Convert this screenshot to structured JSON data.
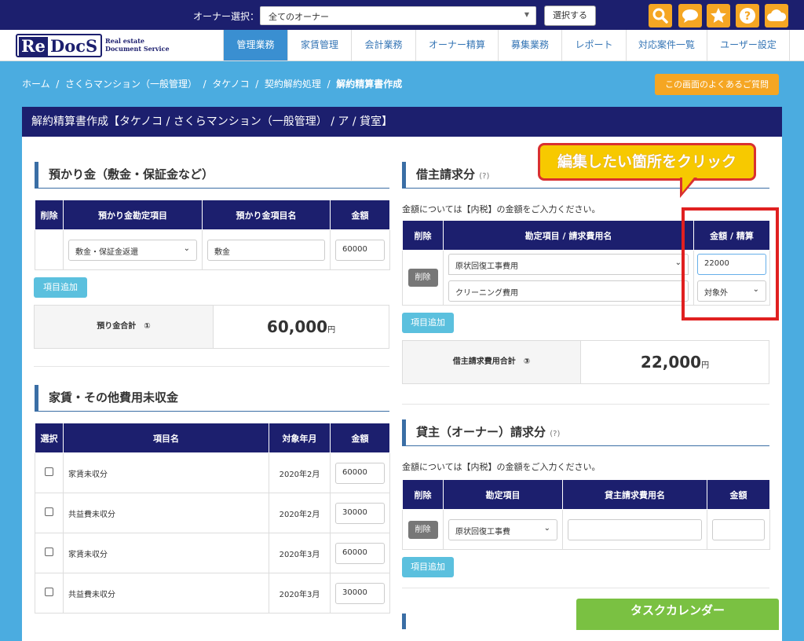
{
  "topbar": {
    "owner_label": "オーナー選択：",
    "owner_select_value": "全てのオーナー",
    "select_button": "選択する",
    "icons": [
      "search-icon",
      "chat-icon",
      "star-icon",
      "help-icon",
      "cloud-icon"
    ],
    "accent": "#f5a623"
  },
  "logo": {
    "re": "Re",
    "docs": "DocS",
    "sub1": "Real estate",
    "sub2": "Document Service"
  },
  "nav": {
    "items": [
      "管理業務",
      "家賃管理",
      "会計業務",
      "オーナー精算",
      "募集業務",
      "レポート",
      "対応案件一覧",
      "ユーザー設定"
    ],
    "active_index": 0
  },
  "breadcrumb": {
    "items": [
      "ホーム",
      "さくらマンション（一般管理）",
      "タケノコ",
      "契約解約処理"
    ],
    "current": "解約精算書作成",
    "sep": "/"
  },
  "faq_button": "この画面のよくあるご質問",
  "page_title": "解約精算書作成【タケノコ / さくらマンション（一般管理） / ア / 貸室】",
  "deposit": {
    "title": "預かり金（敷金・保証金など）",
    "headers": [
      "削除",
      "預かり金勘定項目",
      "預かり金項目名",
      "金額"
    ],
    "row": {
      "account": "敷金・保証金返還",
      "name": "敷金",
      "amount": "60000"
    },
    "add_button": "項目追加",
    "sum_label": "預り金合計　①",
    "sum_value": "60,000",
    "unit": "円"
  },
  "arrears": {
    "title": "家賃・その他費用未収金",
    "headers": [
      "選択",
      "項目名",
      "対象年月",
      "金額"
    ],
    "rows": [
      {
        "name": "家賃未収分",
        "month": "2020年2月",
        "amount": "60000"
      },
      {
        "name": "共益費未収分",
        "month": "2020年2月",
        "amount": "30000"
      },
      {
        "name": "家賃未収分",
        "month": "2020年3月",
        "amount": "60000"
      },
      {
        "name": "共益費未収分",
        "month": "2020年3月",
        "amount": "30000"
      }
    ]
  },
  "tenant": {
    "title": "借主請求分",
    "help": "(?)",
    "note": "金額については【内税】の金額をご入力ください。",
    "headers": [
      "削除",
      "勘定項目 / 請求費用名",
      "金額 / 精算"
    ],
    "delete_button": "削除",
    "item_account": "原状回復工事費用",
    "item_name": "クリーニング費用",
    "amount": "22000",
    "settle": "対象外",
    "add_button": "項目追加",
    "sum_label": "借主請求費用合計　③",
    "sum_value": "22,000",
    "unit": "円"
  },
  "landlord": {
    "title": "貸主（オーナー）請求分",
    "help": "(?)",
    "note": "金額については【内税】の金額をご入力ください。",
    "headers": [
      "削除",
      "勘定項目",
      "貸主請求費用名",
      "金額"
    ],
    "delete_button": "削除",
    "account": "原状回復工事費",
    "name": "",
    "amount": "",
    "add_button": "項目追加"
  },
  "callout": "編集したい箇所をクリック",
  "task_calendar": "タスクカレンダー"
}
